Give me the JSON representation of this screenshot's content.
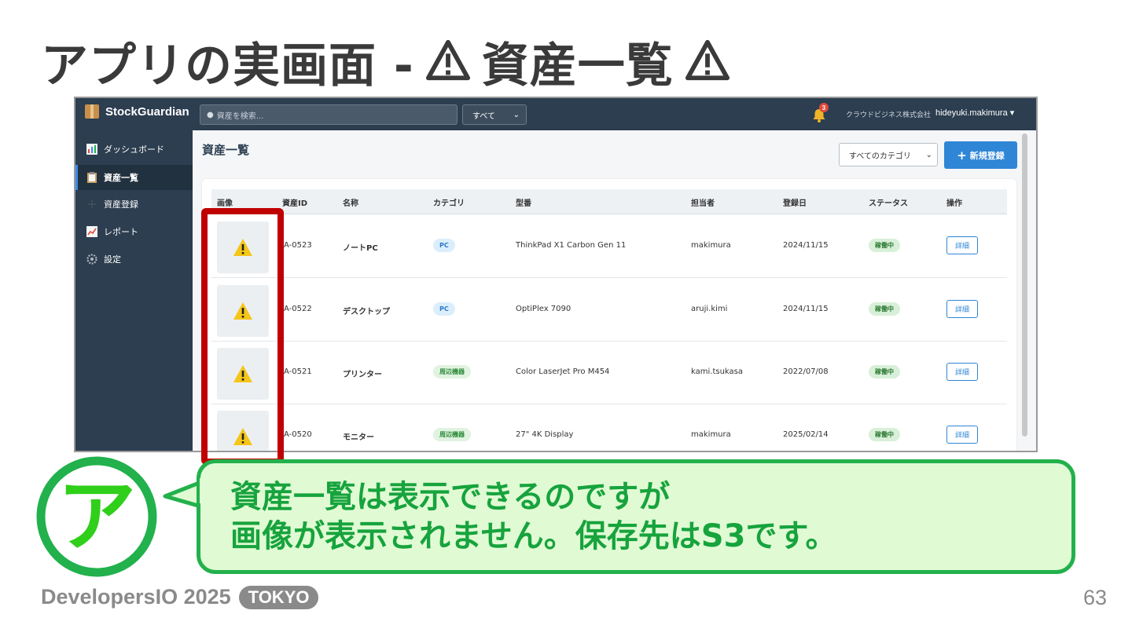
{
  "slide": {
    "title_prefix": "アプリの実画面 -",
    "title_main": "資産一覧",
    "footer_brand": "DevelopersIO 2025",
    "footer_tag": "TOKYO",
    "page_number": "63"
  },
  "app": {
    "brand": "StockGuardian",
    "search_placeholder": "資産を検索...",
    "scope": "すべて",
    "notification_count": "3",
    "company": "クラウドビジネス株式会社",
    "user": "hideyuki.makimura ▾",
    "nav": [
      {
        "label": "ダッシュボード"
      },
      {
        "label": "資産一覧"
      },
      {
        "label": "資産登録"
      },
      {
        "label": "レポート"
      },
      {
        "label": "設定"
      }
    ],
    "page_heading": "資産一覧",
    "category_filter": "すべてのカテゴリ",
    "new_button": "新規登録",
    "columns": [
      "画像",
      "資産ID",
      "名称",
      "カテゴリ",
      "型番",
      "担当者",
      "登録日",
      "ステータス",
      "操作"
    ],
    "rows": [
      {
        "id": "A-0523",
        "name": "ノートPC",
        "category": "PC",
        "model": "ThinkPad X1 Carbon Gen 11",
        "owner": "makimura",
        "date": "2024/11/15",
        "status": "稼働中",
        "action": "詳細"
      },
      {
        "id": "A-0522",
        "name": "デスクトップ",
        "category": "PC",
        "model": "OptiPlex 7090",
        "owner": "aruji.kimi",
        "date": "2024/11/15",
        "status": "稼働中",
        "action": "詳細"
      },
      {
        "id": "A-0521",
        "name": "プリンター",
        "category": "周辺機器",
        "model": "Color LaserJet Pro M454",
        "owner": "kami.tsukasa",
        "date": "2022/07/08",
        "status": "稼働中",
        "action": "詳細"
      },
      {
        "id": "A-0520",
        "name": "モニター",
        "category": "周辺機器",
        "model": "27\" 4K Display",
        "owner": "makimura",
        "date": "2025/02/14",
        "status": "稼働中",
        "action": "詳細"
      }
    ]
  },
  "speech": {
    "avatar_letter": "ア",
    "line1": "資産一覧は表示できるのですが",
    "line2": "画像が表示されません。保存先はS3です。"
  },
  "colors": {
    "app_navy": "#2c3e50",
    "primary_blue": "#2f86d6",
    "highlight_red": "#c00000",
    "bubble_green": "#22b14c",
    "bubble_fill": "#e0fbd4"
  }
}
